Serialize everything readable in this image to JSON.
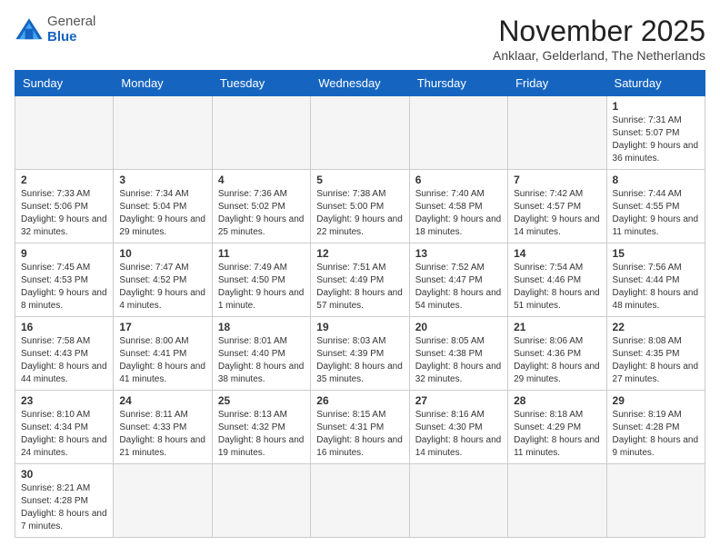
{
  "logo": {
    "general": "General",
    "blue": "Blue"
  },
  "title": "November 2025",
  "subtitle": "Anklaar, Gelderland, The Netherlands",
  "days_of_week": [
    "Sunday",
    "Monday",
    "Tuesday",
    "Wednesday",
    "Thursday",
    "Friday",
    "Saturday"
  ],
  "weeks": [
    [
      {
        "day": "",
        "info": ""
      },
      {
        "day": "",
        "info": ""
      },
      {
        "day": "",
        "info": ""
      },
      {
        "day": "",
        "info": ""
      },
      {
        "day": "",
        "info": ""
      },
      {
        "day": "",
        "info": ""
      },
      {
        "day": "1",
        "info": "Sunrise: 7:31 AM\nSunset: 5:07 PM\nDaylight: 9 hours and 36 minutes."
      }
    ],
    [
      {
        "day": "2",
        "info": "Sunrise: 7:33 AM\nSunset: 5:06 PM\nDaylight: 9 hours and 32 minutes."
      },
      {
        "day": "3",
        "info": "Sunrise: 7:34 AM\nSunset: 5:04 PM\nDaylight: 9 hours and 29 minutes."
      },
      {
        "day": "4",
        "info": "Sunrise: 7:36 AM\nSunset: 5:02 PM\nDaylight: 9 hours and 25 minutes."
      },
      {
        "day": "5",
        "info": "Sunrise: 7:38 AM\nSunset: 5:00 PM\nDaylight: 9 hours and 22 minutes."
      },
      {
        "day": "6",
        "info": "Sunrise: 7:40 AM\nSunset: 4:58 PM\nDaylight: 9 hours and 18 minutes."
      },
      {
        "day": "7",
        "info": "Sunrise: 7:42 AM\nSunset: 4:57 PM\nDaylight: 9 hours and 14 minutes."
      },
      {
        "day": "8",
        "info": "Sunrise: 7:44 AM\nSunset: 4:55 PM\nDaylight: 9 hours and 11 minutes."
      }
    ],
    [
      {
        "day": "9",
        "info": "Sunrise: 7:45 AM\nSunset: 4:53 PM\nDaylight: 9 hours and 8 minutes."
      },
      {
        "day": "10",
        "info": "Sunrise: 7:47 AM\nSunset: 4:52 PM\nDaylight: 9 hours and 4 minutes."
      },
      {
        "day": "11",
        "info": "Sunrise: 7:49 AM\nSunset: 4:50 PM\nDaylight: 9 hours and 1 minute."
      },
      {
        "day": "12",
        "info": "Sunrise: 7:51 AM\nSunset: 4:49 PM\nDaylight: 8 hours and 57 minutes."
      },
      {
        "day": "13",
        "info": "Sunrise: 7:52 AM\nSunset: 4:47 PM\nDaylight: 8 hours and 54 minutes."
      },
      {
        "day": "14",
        "info": "Sunrise: 7:54 AM\nSunset: 4:46 PM\nDaylight: 8 hours and 51 minutes."
      },
      {
        "day": "15",
        "info": "Sunrise: 7:56 AM\nSunset: 4:44 PM\nDaylight: 8 hours and 48 minutes."
      }
    ],
    [
      {
        "day": "16",
        "info": "Sunrise: 7:58 AM\nSunset: 4:43 PM\nDaylight: 8 hours and 44 minutes."
      },
      {
        "day": "17",
        "info": "Sunrise: 8:00 AM\nSunset: 4:41 PM\nDaylight: 8 hours and 41 minutes."
      },
      {
        "day": "18",
        "info": "Sunrise: 8:01 AM\nSunset: 4:40 PM\nDaylight: 8 hours and 38 minutes."
      },
      {
        "day": "19",
        "info": "Sunrise: 8:03 AM\nSunset: 4:39 PM\nDaylight: 8 hours and 35 minutes."
      },
      {
        "day": "20",
        "info": "Sunrise: 8:05 AM\nSunset: 4:38 PM\nDaylight: 8 hours and 32 minutes."
      },
      {
        "day": "21",
        "info": "Sunrise: 8:06 AM\nSunset: 4:36 PM\nDaylight: 8 hours and 29 minutes."
      },
      {
        "day": "22",
        "info": "Sunrise: 8:08 AM\nSunset: 4:35 PM\nDaylight: 8 hours and 27 minutes."
      }
    ],
    [
      {
        "day": "23",
        "info": "Sunrise: 8:10 AM\nSunset: 4:34 PM\nDaylight: 8 hours and 24 minutes."
      },
      {
        "day": "24",
        "info": "Sunrise: 8:11 AM\nSunset: 4:33 PM\nDaylight: 8 hours and 21 minutes."
      },
      {
        "day": "25",
        "info": "Sunrise: 8:13 AM\nSunset: 4:32 PM\nDaylight: 8 hours and 19 minutes."
      },
      {
        "day": "26",
        "info": "Sunrise: 8:15 AM\nSunset: 4:31 PM\nDaylight: 8 hours and 16 minutes."
      },
      {
        "day": "27",
        "info": "Sunrise: 8:16 AM\nSunset: 4:30 PM\nDaylight: 8 hours and 14 minutes."
      },
      {
        "day": "28",
        "info": "Sunrise: 8:18 AM\nSunset: 4:29 PM\nDaylight: 8 hours and 11 minutes."
      },
      {
        "day": "29",
        "info": "Sunrise: 8:19 AM\nSunset: 4:28 PM\nDaylight: 8 hours and 9 minutes."
      }
    ],
    [
      {
        "day": "30",
        "info": "Sunrise: 8:21 AM\nSunset: 4:28 PM\nDaylight: 8 hours and 7 minutes."
      },
      {
        "day": "",
        "info": ""
      },
      {
        "day": "",
        "info": ""
      },
      {
        "day": "",
        "info": ""
      },
      {
        "day": "",
        "info": ""
      },
      {
        "day": "",
        "info": ""
      },
      {
        "day": "",
        "info": ""
      }
    ]
  ]
}
